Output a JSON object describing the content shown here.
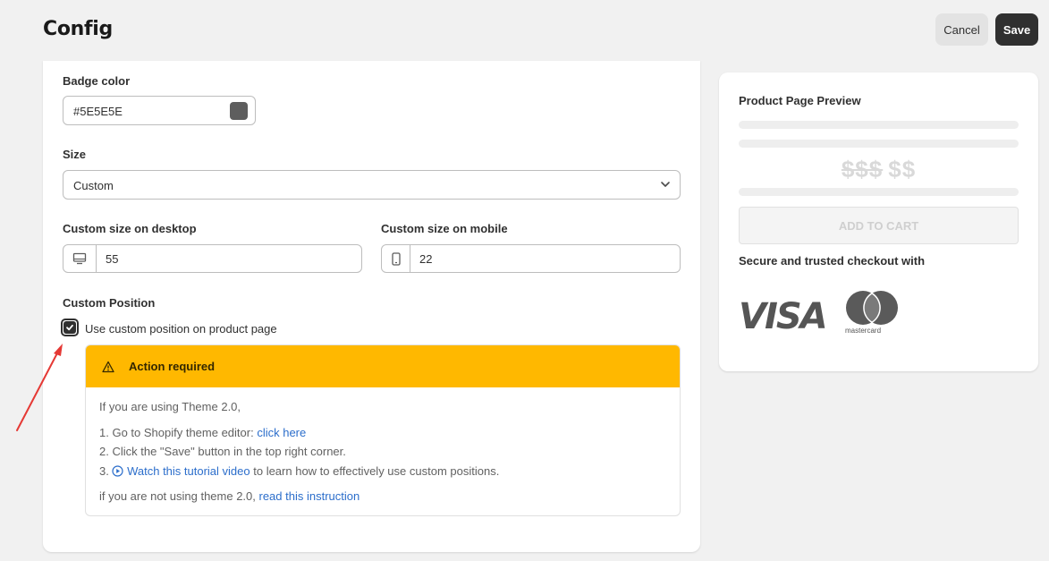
{
  "header": {
    "title": "Config",
    "cancel_label": "Cancel",
    "save_label": "Save"
  },
  "form": {
    "badge_color": {
      "label": "Badge color",
      "value": "#5E5E5E",
      "swatch_color": "#5e5e5e"
    },
    "size": {
      "label": "Size",
      "value": "Custom"
    },
    "desktop_size": {
      "label": "Custom size on desktop",
      "value": "55",
      "icon": "desktop-icon"
    },
    "mobile_size": {
      "label": "Custom size on mobile",
      "value": "22",
      "icon": "mobile-icon"
    },
    "custom_position": {
      "label": "Custom Position",
      "checkbox_label": "Use custom position on product page",
      "checked": true
    },
    "banner": {
      "title": "Action required",
      "intro": "If you are using Theme 2.0,",
      "step1_text": "1. Go to Shopify theme editor: ",
      "step1_link": "click here",
      "step2_text": "2. Click the \"Save\" button in the top right corner.",
      "step3_prefix": "3. ",
      "step3_link": "Watch this tutorial video",
      "step3_suffix": " to learn how to effectively use custom positions.",
      "footer_text": "if you are not using theme 2.0, ",
      "footer_link": "read this instruction"
    }
  },
  "preview": {
    "title": "Product Page Preview",
    "price_old": "$$$",
    "price_new": "$$",
    "add_to_cart": "ADD TO CART",
    "secure_text": "Secure and trusted checkout with",
    "visa_logo": "VISA",
    "mastercard_label": "mastercard"
  },
  "colors": {
    "banner_bg": "#ffb800",
    "link": "#2c6ecb",
    "primary_button": "#303030",
    "annotation_arrow": "#e53935"
  }
}
